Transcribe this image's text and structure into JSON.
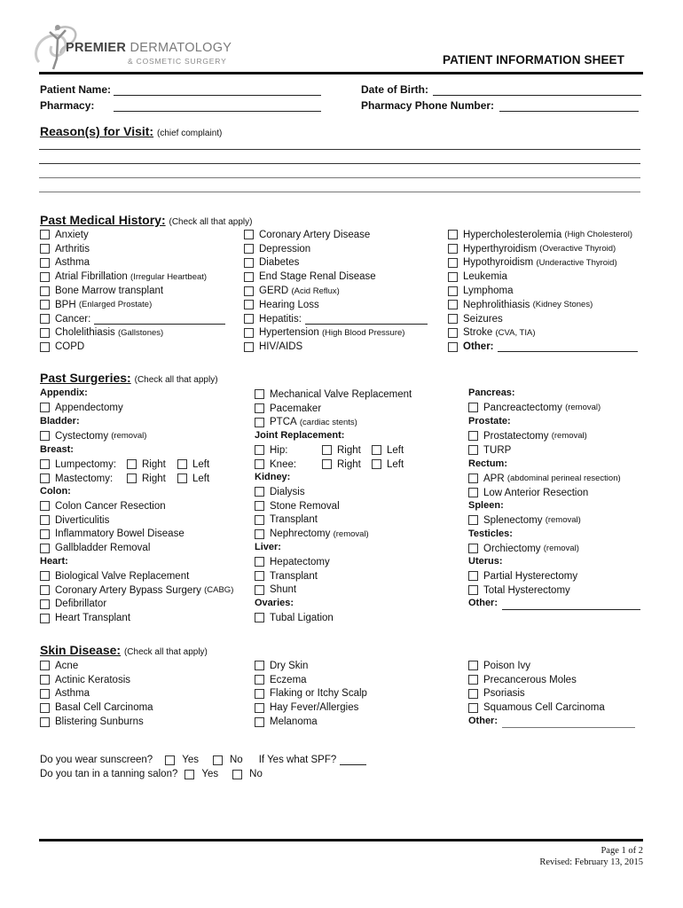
{
  "header": {
    "logo": {
      "icon": "figure-swirl-logo",
      "brand_bold": "PREMIER",
      "brand_light": "DERMATOLOGY",
      "tagline": "& COSMETIC SURGERY"
    },
    "title": "PATIENT INFORMATION SHEET"
  },
  "patient_fields": {
    "patient_name": {
      "label": "Patient Name:",
      "value": ""
    },
    "pharmacy": {
      "label": "Pharmacy:",
      "value": ""
    },
    "date_of_birth": {
      "label": "Date of Birth:",
      "value": ""
    },
    "pharmacy_phone": {
      "label": "Pharmacy Phone Number:",
      "value": ""
    }
  },
  "reason": {
    "heading": "Reason(s) for Visit:",
    "note": "(chief complaint)",
    "lines": [
      "",
      "",
      "",
      ""
    ]
  },
  "medical_history": {
    "heading": "Past Medical History:",
    "note": "(Check all that apply)",
    "col1": [
      {
        "label": "Anxiety",
        "sub": ""
      },
      {
        "label": "Arthritis",
        "sub": ""
      },
      {
        "label": "Asthma",
        "sub": ""
      },
      {
        "label": "Atrial Fibrillation",
        "sub": "(Irregular Heartbeat)"
      },
      {
        "label": "Bone Marrow transplant",
        "sub": ""
      },
      {
        "label": "BPH",
        "sub": "(Enlarged Prostate)"
      },
      {
        "label": "Cancer:",
        "sub": ""
      },
      {
        "label": "Cholelithiasis",
        "sub": "(Gallstones)"
      },
      {
        "label": "COPD",
        "sub": ""
      }
    ],
    "col2": [
      {
        "label": "Coronary Artery Disease",
        "sub": ""
      },
      {
        "label": "Depression",
        "sub": ""
      },
      {
        "label": "Diabetes",
        "sub": ""
      },
      {
        "label": "End Stage Renal Disease",
        "sub": ""
      },
      {
        "label": "GERD",
        "sub": "(Acid Reflux)"
      },
      {
        "label": "Hearing Loss",
        "sub": ""
      },
      {
        "label": "Hepatitis:",
        "sub": ""
      },
      {
        "label": "Hypertension",
        "sub": "(High Blood Pressure)"
      },
      {
        "label": "HIV/AIDS",
        "sub": ""
      }
    ],
    "col3": [
      {
        "label": "Hypercholesterolemia",
        "sub": "(High Cholesterol)"
      },
      {
        "label": "Hyperthyroidism",
        "sub": "(Overactive Thyroid)"
      },
      {
        "label": "Hypothyroidism",
        "sub": "(Underactive Thyroid)"
      },
      {
        "label": "Leukemia",
        "sub": ""
      },
      {
        "label": "Lymphoma",
        "sub": ""
      },
      {
        "label": "Nephrolithiasis",
        "sub": "(Kidney Stones)"
      },
      {
        "label": "Seizures",
        "sub": ""
      },
      {
        "label": "Stroke",
        "sub": "(CVA, TIA)"
      },
      {
        "label": "Other:",
        "sub": ""
      }
    ]
  },
  "surgeries": {
    "heading": "Past Surgeries:",
    "note": "(Check all that apply)",
    "appendix": "Appendix:",
    "appendectomy": "Appendectomy",
    "bladder": "Bladder:",
    "cystectomy": "Cystectomy",
    "removal": "(removal)",
    "breast": "Breast:",
    "lumpectomy": "Lumpectomy:",
    "mastectomy": "Mastectomy:",
    "right": "Right",
    "left": "Left",
    "colon": "Colon:",
    "colon_items": [
      "Colon Cancer Resection",
      "Diverticulitis",
      "Inflammatory Bowel Disease",
      "Gallbladder Removal"
    ],
    "heart": "Heart:",
    "heart_items": [
      "Biological Valve Replacement",
      "Coronary Artery Bypass Surgery",
      "Defibrillator",
      "Heart Transplant"
    ],
    "cabg": "(CABG)",
    "heart_items2": [
      "Mechanical Valve Replacement",
      "Pacemaker",
      "PTCA"
    ],
    "ptca_sub": "(cardiac stents)",
    "joint": "Joint Replacement:",
    "hip": "Hip:",
    "knee": "Knee:",
    "kidney": "Kidney:",
    "kidney_items": [
      "Dialysis",
      "Stone Removal",
      "Transplant",
      "Nephrectomy"
    ],
    "liver": "Liver:",
    "liver_items": [
      "Hepatectomy",
      "Transplant",
      "Shunt"
    ],
    "ovaries": "Ovaries:",
    "tubal": "Tubal Ligation",
    "pancreas": "Pancreas:",
    "pancreactectomy": "Pancreactectomy",
    "prostate": "Prostate:",
    "prostatectomy": "Prostatectomy",
    "turp": "TURP",
    "rectum": "Rectum:",
    "apr": "APR",
    "apr_sub": "(abdominal perineal resection)",
    "lar": "Low Anterior Resection",
    "spleen": "Spleen:",
    "splenectomy": "Splenectomy",
    "testicles": "Testicles:",
    "orchiectomy": "Orchiectomy",
    "uterus": "Uterus:",
    "uterus_items": [
      "Partial Hysterectomy",
      "Total Hysterectomy"
    ],
    "other": "Other:"
  },
  "skin": {
    "heading": "Skin Disease:",
    "note": "(Check all that apply)",
    "col1": [
      "Acne",
      "Actinic Keratosis",
      "Asthma",
      "Basal Cell Carcinoma",
      "Blistering Sunburns"
    ],
    "col2": [
      "Dry Skin",
      "Eczema",
      "Flaking or Itchy Scalp",
      "Hay Fever/Allergies",
      "Melanoma"
    ],
    "col3": [
      "Poison Ivy",
      "Precancerous Moles",
      "Psoriasis",
      "Squamous Cell Carcinoma"
    ],
    "other": "Other:"
  },
  "questions": {
    "sunscreen": "Do you wear sunscreen?",
    "tanning": "Do you tan in a tanning salon?",
    "yes": "Yes",
    "no": "No",
    "spf": "If Yes what SPF?"
  },
  "footer": {
    "page": "Page 1 of 2",
    "revised": "Revised:  February 13, 2015"
  }
}
